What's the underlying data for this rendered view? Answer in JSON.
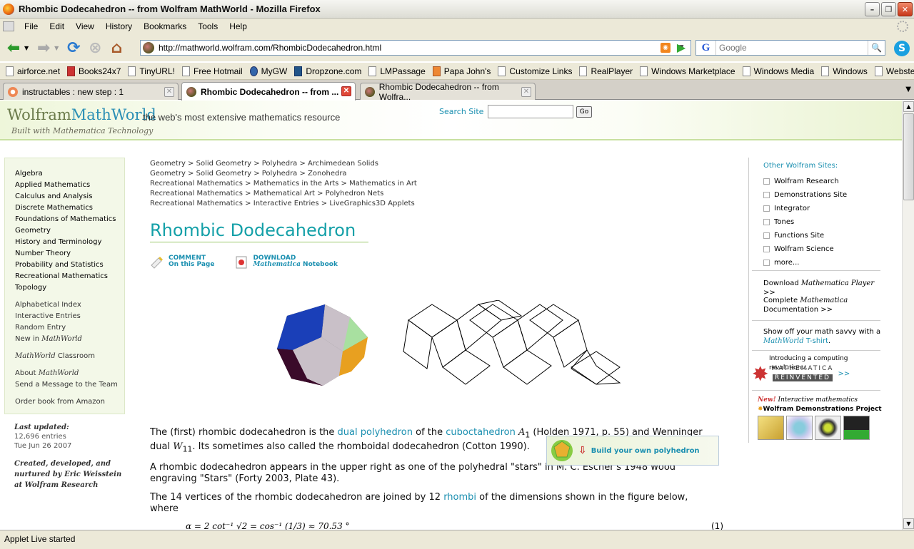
{
  "window": {
    "title": "Rhombic Dodecahedron -- from Wolfram MathWorld - Mozilla Firefox"
  },
  "menu": [
    "File",
    "Edit",
    "View",
    "History",
    "Bookmarks",
    "Tools",
    "Help"
  ],
  "url": "http://mathworld.wolfram.com/RhombicDodecahedron.html",
  "search_placeholder": "Google",
  "bookmarks": [
    "airforce.net",
    "Books24x7",
    "TinyURL!",
    "Free Hotmail",
    "MyGW",
    "Dropzone.com",
    "LMPassage",
    "Papa John's",
    "Customize Links",
    "RealPlayer",
    "Windows Marketplace",
    "Windows Media",
    "Windows",
    "Webster"
  ],
  "tabs": [
    {
      "label": "instructables : new step : 1"
    },
    {
      "label": "Rhombic Dodecahedron -- from ..."
    },
    {
      "label": "Rhombic Dodecahedron -- from Wolfra..."
    }
  ],
  "status": "Applet Live started",
  "site": {
    "logo_a": "Wolfram",
    "logo_b": "MathWorld",
    "tagline": "the web's most extensive mathematics resource",
    "built_with": "Built with Mathematica Technology",
    "search_label": "Search Site",
    "go": "Go"
  },
  "leftnav": {
    "topics": [
      "Algebra",
      "Applied Mathematics",
      "Calculus and Analysis",
      "Discrete Mathematics",
      "Foundations of Mathematics",
      "Geometry",
      "History and Terminology",
      "Number Theory",
      "Probability and Statistics",
      "Recreational Mathematics",
      "Topology"
    ],
    "links": [
      "Alphabetical Index",
      "Interactive Entries",
      "Random Entry"
    ],
    "new_in": "New in ",
    "mw": "MathWorld",
    "classroom": " Classroom",
    "about": "About ",
    "send": "Send a Message to the Team",
    "order": "Order book from Amazon"
  },
  "lastupdated": {
    "label": "Last updated:",
    "entries": "12,696 entries",
    "date": "Tue Jun 26 2007"
  },
  "created": [
    "Created, developed, and",
    "nurtured by Eric Weisstein",
    "at Wolfram Research"
  ],
  "breadcrumbs": [
    "Geometry > Solid Geometry > Polyhedra > Archimedean Solids",
    "Geometry > Solid Geometry > Polyhedra > Zonohedra",
    "Recreational Mathematics > Mathematics in the Arts > Mathematics in Art",
    "Recreational Mathematics > Mathematical Art > Polyhedron Nets",
    "Recreational Mathematics > Interactive Entries > LiveGraphics3D Applets"
  ],
  "page_title": "Rhombic Dodecahedron",
  "actions": {
    "comment": "COMMENT",
    "comment2": "On this Page",
    "download": "DOWNLOAD",
    "download2a": "Mathematica",
    "download2b": " Notebook"
  },
  "para1": {
    "a": "The (first) rhombic dodecahedron is the ",
    "link1": "dual polyhedron",
    "b": " of the ",
    "link2": "cuboctahedron",
    "sym1": " A",
    "sub1": "1",
    "c": " (Holden 1971, p. 55) and Wenninger dual ",
    "sym2": "W",
    "sub2": "11",
    "d": ". Its sometimes also called the rhomboidal dodecahedron (Cotton 1990)."
  },
  "para2": "A rhombic dodecahedron appears in the upper right as one of the polyhedral \"stars\" in M. C. Escher's 1948 wood engraving \"Stars\" (Forty 2003, Plate 43).",
  "para3": {
    "a": "The 14 vertices of the rhombic dodecahedron are joined by 12 ",
    "link": "rhombi",
    "b": " of the dimensions shown in the figure below, where"
  },
  "equation": "α = 2 cot⁻¹ √2 = cos⁻¹ (1/3) ≈ 70.53 °",
  "equation_num": "(1)",
  "build_box": "Build your own polyhedron",
  "rightcol": {
    "heading": "Other Wolfram Sites:",
    "sites": [
      "Wolfram Research",
      "Demonstrations Site",
      "Integrator",
      "Tones",
      "Functions Site",
      "Wolfram Science",
      "more..."
    ],
    "download_player_a": "Download ",
    "download_player_b": "Mathematica Player",
    "download_player_c": " >>",
    "complete_a": "Complete ",
    "complete_b": "Mathematica",
    "complete_c": "Documentation >>",
    "tshirt_a": "Show off your math savvy with a ",
    "tshirt_b": "MathWorld",
    "tshirt_c": " T-shirt",
    "tshirt_d": ".",
    "intro": "Introducing a computing revolution...",
    "mm1": "MATHEMATICA",
    "mm2": "REINVENTED",
    "mm_arrow": ">>",
    "new": "New!",
    "interactive": " Interactive mathematics",
    "demo_project": "Wolfram Demonstrations Project",
    "demo_arrow": " >>"
  }
}
